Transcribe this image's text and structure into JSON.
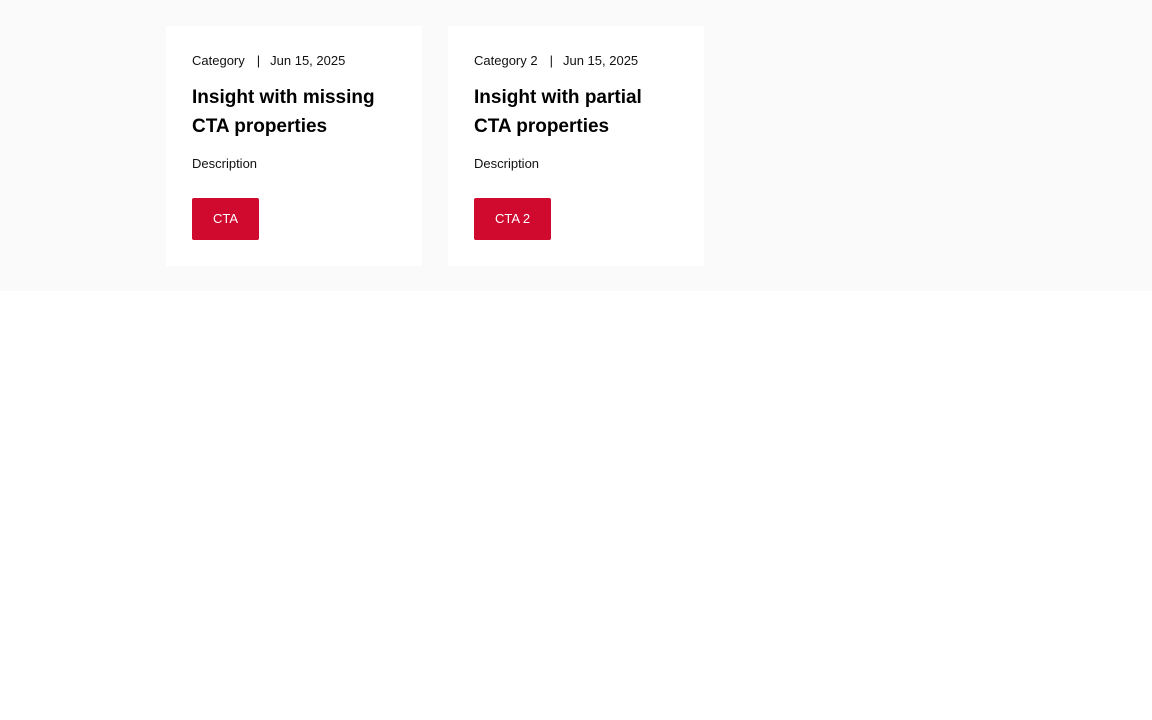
{
  "colors": {
    "band_background": "#fafafa",
    "card_background": "#ffffff",
    "cta_background": "#d0092f",
    "cta_text": "#ffffff"
  },
  "cards": [
    {
      "category": "Category",
      "separator": "|",
      "date": "Jun 15, 2025",
      "title": "Insight with missing CTA properties",
      "description": "Description",
      "cta_label": "CTA"
    },
    {
      "category": "Category 2",
      "separator": "|",
      "date": "Jun 15, 2025",
      "title": "Insight with partial CTA properties",
      "description": "Description",
      "cta_label": "CTA 2"
    }
  ]
}
